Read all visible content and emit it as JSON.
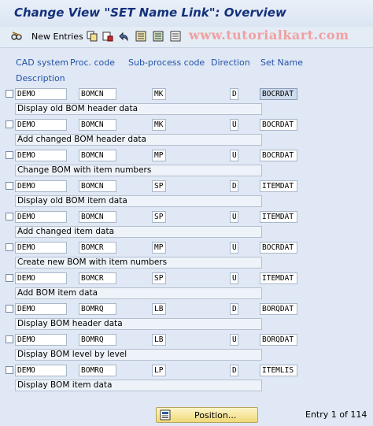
{
  "window": {
    "title": "Change View \"SET Name Link\": Overview"
  },
  "toolbar": {
    "new_entries_label": "New Entries",
    "watermark": "www.tutorialkart.com",
    "icons": [
      "glasses-icon",
      "copy-icon",
      "delete-icon",
      "undo-icon",
      "select-all-icon",
      "select-block-icon",
      "deselect-icon"
    ]
  },
  "table": {
    "headers": {
      "cad_system": "CAD system",
      "proc_code": "Proc. code",
      "subprocess_code": "Sub-process code",
      "direction": "Direction",
      "set_name": "Set Name",
      "description": "Description"
    },
    "rows": [
      {
        "cad": "DEMO",
        "proc": "BOMCN",
        "sub": "MK",
        "dir": "D",
        "set": "BOCRDAT",
        "desc": "Display old BOM header data"
      },
      {
        "cad": "DEMO",
        "proc": "BOMCN",
        "sub": "MK",
        "dir": "U",
        "set": "BOCRDAT",
        "desc": "Add changed BOM header data"
      },
      {
        "cad": "DEMO",
        "proc": "BOMCN",
        "sub": "MP",
        "dir": "U",
        "set": "BOCRDAT",
        "desc": "Change BOM with item numbers"
      },
      {
        "cad": "DEMO",
        "proc": "BOMCN",
        "sub": "SP",
        "dir": "D",
        "set": "ITEMDAT",
        "desc": "Display old BOM item data"
      },
      {
        "cad": "DEMO",
        "proc": "BOMCN",
        "sub": "SP",
        "dir": "U",
        "set": "ITEMDAT",
        "desc": "Add changed item data"
      },
      {
        "cad": "DEMO",
        "proc": "BOMCR",
        "sub": "MP",
        "dir": "U",
        "set": "BOCRDAT",
        "desc": "Create new BOM with item numbers"
      },
      {
        "cad": "DEMO",
        "proc": "BOMCR",
        "sub": "SP",
        "dir": "U",
        "set": "ITEMDAT",
        "desc": "Add BOM item data"
      },
      {
        "cad": "DEMO",
        "proc": "BOMRQ",
        "sub": "LB",
        "dir": "D",
        "set": "BORQDAT",
        "desc": "Display BOM header data"
      },
      {
        "cad": "DEMO",
        "proc": "BOMRQ",
        "sub": "LB",
        "dir": "U",
        "set": "BORQDAT",
        "desc": "Display BOM level by level"
      },
      {
        "cad": "DEMO",
        "proc": "BOMRQ",
        "sub": "LP",
        "dir": "D",
        "set": "ITEMLIS",
        "desc": "Display BOM item data"
      }
    ]
  },
  "footer": {
    "position_label": "Position...",
    "entry_text": "Entry 1 of 114"
  }
}
